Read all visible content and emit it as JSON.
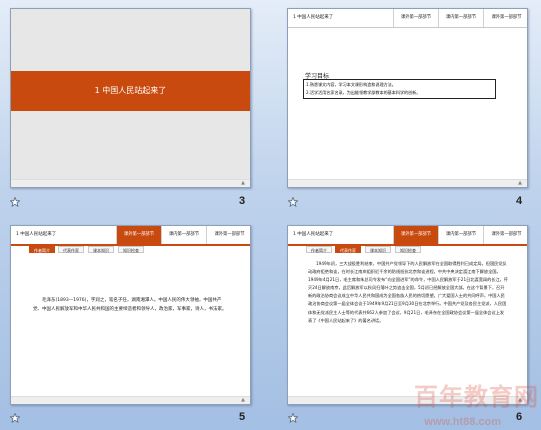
{
  "slides": [
    {
      "number": "3",
      "title": "1   中国人民站起来了"
    },
    {
      "number": "4",
      "header_label": "1  中国人民站起来了",
      "tabs": [
        "课外第一部部节",
        "课内第一部部节",
        "课外第一部部节"
      ],
      "goal_title": "学习目标",
      "goals": [
        "1.熟悉课文内容，学习本文课形构造和说理方法。",
        "2.活学活用名家名录，为出能领教学部教本的基本科学的创新。"
      ]
    },
    {
      "number": "5",
      "header_label": "1  中国人民站起来了",
      "tabs": [
        "课外第一部部节",
        "课内第一部部节",
        "课外第一部部节"
      ],
      "subtabs": [
        "作者简介",
        "代表作家",
        "课本知识",
        "知识检查"
      ],
      "paragraph": "毛泽东(1893—1976)，字润之，笔名子任，湖南湘潭人。中国人民的伟大领袖，中国共产党、中国人民解放军和中华人民共和国的主要缔造者和领导人，政治家，军事家，诗人，书法家。"
    },
    {
      "number": "6",
      "header_label": "1  中国人民站起来了",
      "tabs": [
        "课外第一部部节",
        "课内第一部部节",
        "课外第一部部节"
      ],
      "subtabs": [
        "作者简介",
        "代表作家",
        "课本知识",
        "知识检查"
      ],
      "paragraph": "1949年初，三大战役胜利结束，中国共产党领导下的人民解放军在全国取得胜利已成定局。但国民党反动政府拒绝和谈，在时长江南岸组织近千余的防线抵抗北京和谈进程，中共中央决定渡江南下解放全国。1949年4月21日，毛主席和朱总司令发布“向全国进军”的命令，中国人民解放军于21日北渡宽阔的长江，歼灭24日解放南京，此后解放军以秋风扫落叶之势追击全国，5月初已经解放全国大部。在这个背景下，召开新的政治协商会议成立中华人民共和国成为全国各族人民的热切愿望。广大爱国人士的共同呼声，中国人民政治协商会议第一届全体会议于1949年9月21日至9月30日在北京举行。中国共产党及各民主党派，人民团体和无党派民主人士等的代表共662人参加了会议，9月21日，毛泽东在全国政协会议第一届全体会议上发表了《中国人民站起来了》的著名讲话。"
    }
  ],
  "watermark": {
    "text": "百年教育网",
    "url": "www.ht88.com"
  }
}
